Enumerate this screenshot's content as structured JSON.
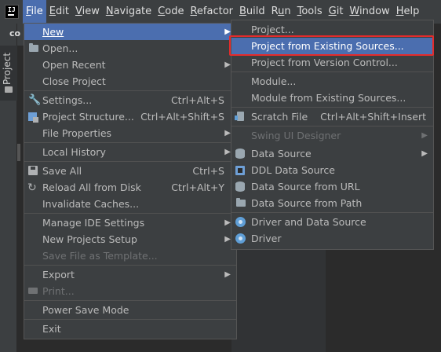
{
  "app": {
    "logo_text": "IJ"
  },
  "menubar": {
    "items": [
      {
        "label": "File",
        "mnemonic": "F",
        "rest": "ile"
      },
      {
        "label": "Edit",
        "mnemonic": "E",
        "rest": "dit"
      },
      {
        "label": "View",
        "mnemonic": "V",
        "rest": "iew"
      },
      {
        "label": "Navigate",
        "mnemonic": "N",
        "rest": "avigate"
      },
      {
        "label": "Code",
        "mnemonic": "C",
        "rest": "ode"
      },
      {
        "label": "Refactor",
        "mnemonic": "R",
        "rest": "efactor"
      },
      {
        "label": "Build",
        "mnemonic": "B",
        "rest": "uild"
      },
      {
        "label": "Run",
        "mnemonic": "u",
        "pre": "R",
        "rest": "n"
      },
      {
        "label": "Tools",
        "mnemonic": "T",
        "rest": "ools"
      },
      {
        "label": "Git",
        "mnemonic": "G",
        "rest": "it"
      },
      {
        "label": "Window",
        "mnemonic": "W",
        "rest": "indow"
      },
      {
        "label": "Help",
        "mnemonic": "H",
        "rest": "elp"
      }
    ]
  },
  "side": {
    "project_tab": "Project",
    "tab_strip_text": "co"
  },
  "file_menu": {
    "new": "New",
    "open": "Open...",
    "open_recent": "Open Recent",
    "close_project": "Close Project",
    "settings": "Settings...",
    "settings_sc": "Ctrl+Alt+S",
    "project_structure": "Project Structure...",
    "project_structure_sc": "Ctrl+Alt+Shift+S",
    "file_properties": "File Properties",
    "local_history": "Local History",
    "save_all": "Save All",
    "save_all_sc": "Ctrl+S",
    "reload_all": "Reload All from Disk",
    "reload_all_sc": "Ctrl+Alt+Y",
    "invalidate_caches": "Invalidate Caches...",
    "manage_ide": "Manage IDE Settings",
    "new_projects_setup": "New Projects Setup",
    "save_as_template": "Save File as Template...",
    "export": "Export",
    "print": "Print...",
    "power_save": "Power Save Mode",
    "exit": "Exit"
  },
  "new_menu": {
    "project": "Project...",
    "project_existing": "Project from Existing Sources...",
    "project_vcs": "Project from Version Control...",
    "module": "Module...",
    "module_existing": "Module from Existing Sources...",
    "scratch": "Scratch File",
    "scratch_sc": "Ctrl+Alt+Shift+Insert",
    "swing": "Swing UI Designer",
    "data_source": "Data Source",
    "ddl": "DDL Data Source",
    "ds_url": "Data Source from URL",
    "ds_path": "Data Source from Path",
    "driver_ds": "Driver and Data Source",
    "driver": "Driver"
  }
}
